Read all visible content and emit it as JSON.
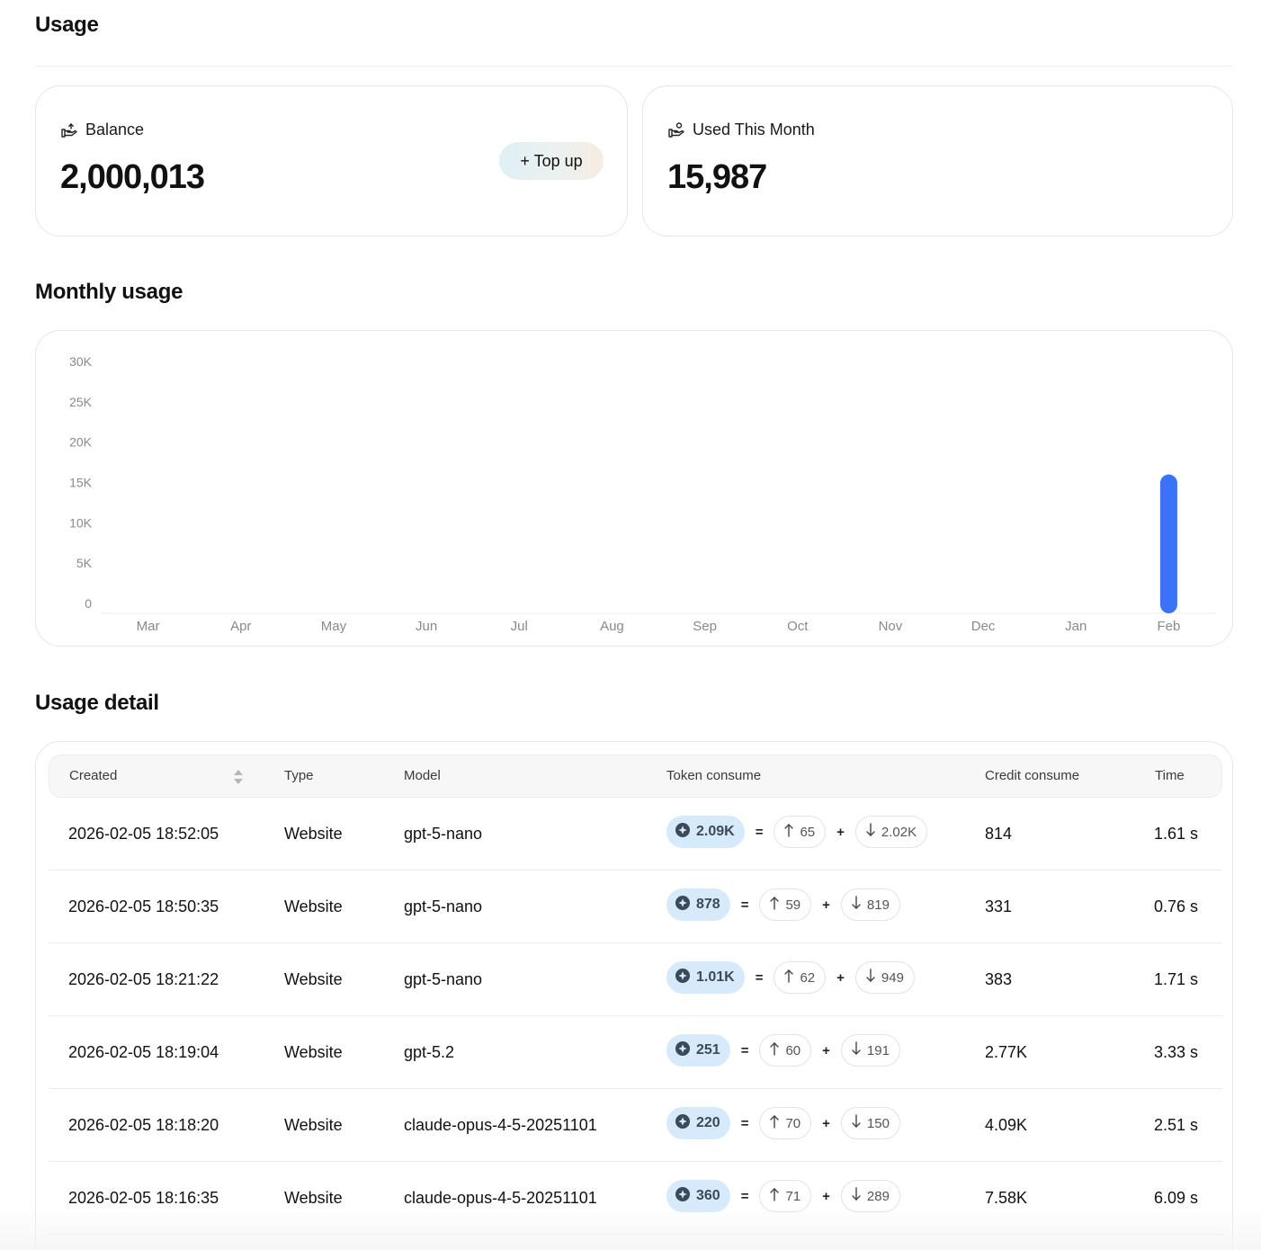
{
  "page": {
    "title": "Usage"
  },
  "cards": {
    "balance": {
      "label": "Balance",
      "value": "2,000,013",
      "button": "+ Top up",
      "icon": "wallet-icon"
    },
    "used": {
      "label": "Used This Month",
      "value": "15,987",
      "icon": "coins-hand-icon"
    }
  },
  "monthly": {
    "title": "Monthly usage"
  },
  "chart_data": {
    "type": "bar",
    "categories": [
      "Mar",
      "Apr",
      "May",
      "Jun",
      "Jul",
      "Aug",
      "Sep",
      "Oct",
      "Nov",
      "Dec",
      "Jan",
      "Feb"
    ],
    "values": [
      0,
      0,
      0,
      0,
      0,
      0,
      0,
      0,
      0,
      0,
      0,
      15987
    ],
    "ylim": [
      0,
      30000
    ],
    "yticks": [
      0,
      5000,
      10000,
      15000,
      20000,
      25000,
      30000
    ],
    "ytick_labels": [
      "0",
      "5K",
      "10K",
      "15K",
      "20K",
      "25K",
      "30K"
    ],
    "bar_color": "#3b73f6",
    "grid": false,
    "title": "",
    "xlabel": "",
    "ylabel": ""
  },
  "detail": {
    "title": "Usage detail",
    "columns": [
      "Created",
      "Type",
      "Model",
      "Token consume",
      "Credit consume",
      "Time"
    ],
    "rows": [
      {
        "created": "2026-02-05 18:52:05",
        "type": "Website",
        "model": "gpt-5-nano",
        "total": "2.09K",
        "input": "65",
        "output": "2.02K",
        "credit": "814",
        "time": "1.61 s"
      },
      {
        "created": "2026-02-05 18:50:35",
        "type": "Website",
        "model": "gpt-5-nano",
        "total": "878",
        "input": "59",
        "output": "819",
        "credit": "331",
        "time": "0.76 s"
      },
      {
        "created": "2026-02-05 18:21:22",
        "type": "Website",
        "model": "gpt-5-nano",
        "total": "1.01K",
        "input": "62",
        "output": "949",
        "credit": "383",
        "time": "1.71 s"
      },
      {
        "created": "2026-02-05 18:19:04",
        "type": "Website",
        "model": "gpt-5.2",
        "total": "251",
        "input": "60",
        "output": "191",
        "credit": "2.77K",
        "time": "3.33 s"
      },
      {
        "created": "2026-02-05 18:18:20",
        "type": "Website",
        "model": "claude-opus-4-5-20251101",
        "total": "220",
        "input": "70",
        "output": "150",
        "credit": "4.09K",
        "time": "2.51 s"
      },
      {
        "created": "2026-02-05 18:16:35",
        "type": "Website",
        "model": "claude-opus-4-5-20251101",
        "total": "360",
        "input": "71",
        "output": "289",
        "credit": "7.58K",
        "time": "6.09 s"
      }
    ],
    "ops": {
      "equals": "=",
      "plus": "+"
    }
  }
}
